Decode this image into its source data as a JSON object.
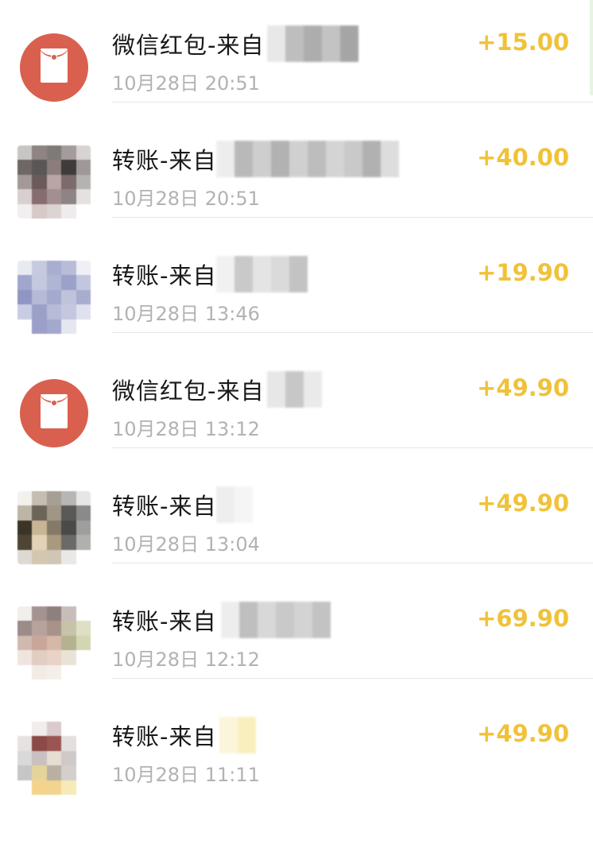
{
  "transactions": [
    {
      "type": "redpacket",
      "title": "微信红包-来自",
      "date": "10月28日 20:51",
      "amount": "+15.00"
    },
    {
      "type": "transfer",
      "title": "转账-来自",
      "date": "10月28日 20:51",
      "amount": "+40.00"
    },
    {
      "type": "transfer",
      "title": "转账-来自",
      "date": "10月28日 13:46",
      "amount": "+19.90"
    },
    {
      "type": "redpacket",
      "title": "微信红包-来自",
      "date": "10月28日 13:12",
      "amount": "+49.90"
    },
    {
      "type": "transfer",
      "title": "转账-来自",
      "date": "10月28日 13:04",
      "amount": "+49.90"
    },
    {
      "type": "transfer",
      "title": "转账-来自",
      "date": "10月28日 12:12",
      "amount": "+69.90"
    },
    {
      "type": "transfer",
      "title": "转账-来自",
      "date": "10月28日 11:11",
      "amount": "+49.90"
    }
  ],
  "colors": {
    "amount": "#f0c239",
    "redpacket": "#d9604e",
    "date": "#b2b2b2"
  }
}
